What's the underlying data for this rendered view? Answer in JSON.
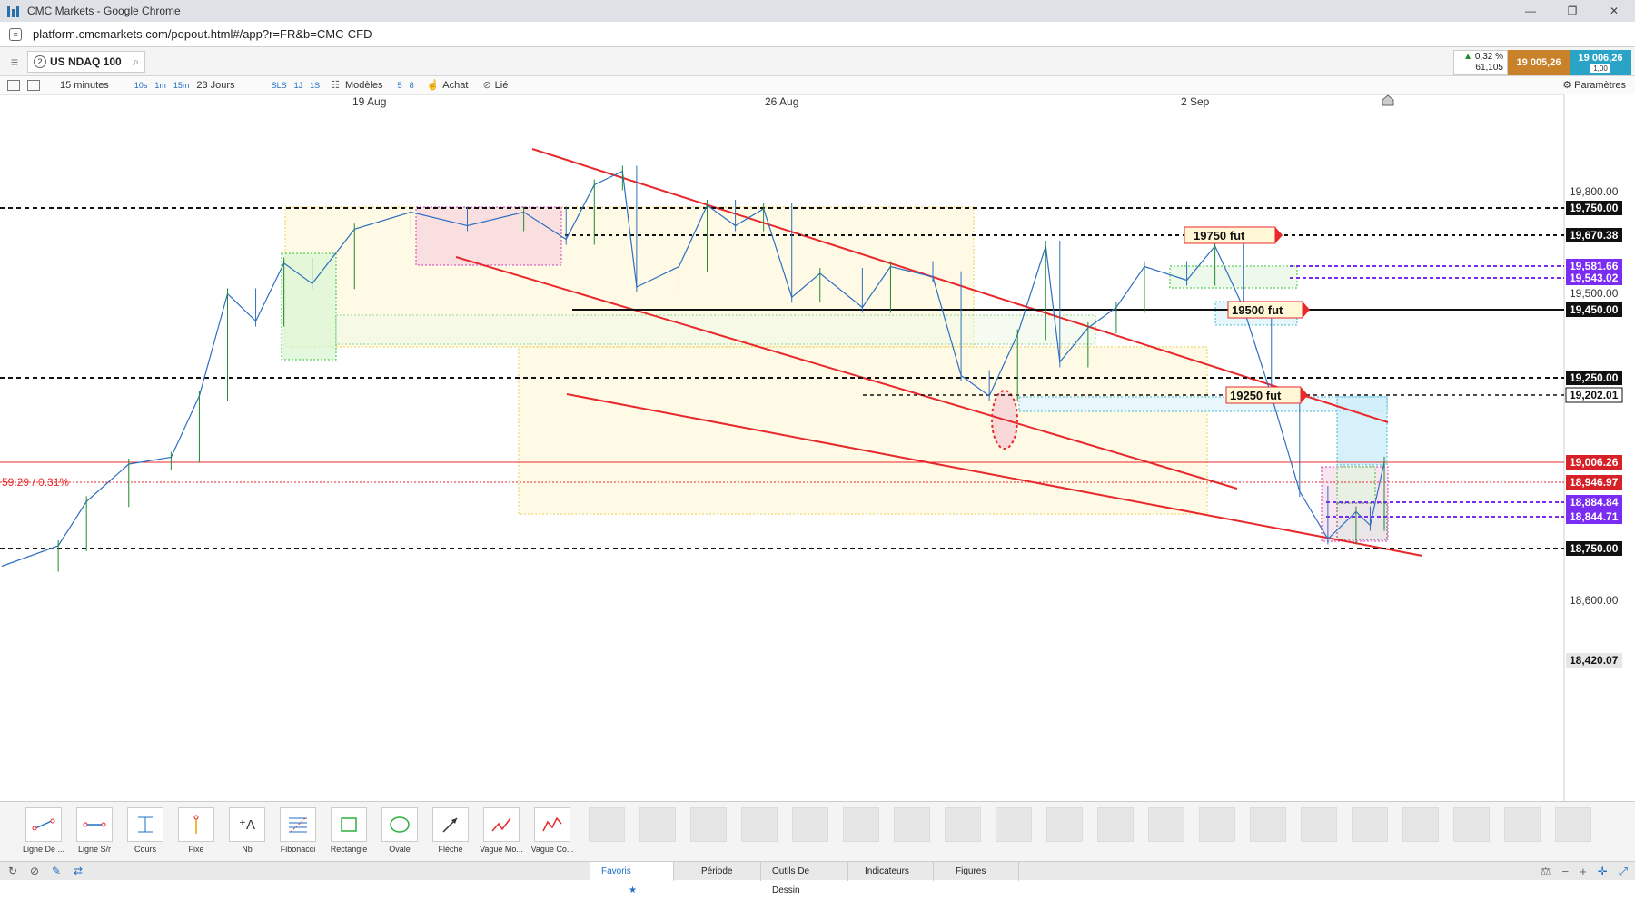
{
  "browser": {
    "window_title": "CMC Markets - Google Chrome",
    "url": "platform.cmcmarkets.com/popout.html#/app?r=FR&b=CMC-CFD"
  },
  "instrument": {
    "badge": "2",
    "name": "US NDAQ 100"
  },
  "quote": {
    "change_pct": "0,32 %",
    "change_pts": "61,105",
    "sell": "19 005,26",
    "buy": "19 006,26",
    "spread": "1,00"
  },
  "toolbar": {
    "interval": "15 minutes",
    "quick_intervals": [
      "10s",
      "1m",
      "15m"
    ],
    "range": "23 Jours",
    "quick_ranges": [
      "SLS",
      "1J",
      "1S"
    ],
    "templates": "Modèles",
    "num1": "5",
    "num2": "8",
    "buy_label": "Achat",
    "link_label": "Lié",
    "settings": "Paramètres"
  },
  "chart_data": {
    "type": "line",
    "x_labels": [
      "19 Aug",
      "26 Aug",
      "2 Sep"
    ],
    "y_ticks": [
      "19,800.00",
      "19,500.00",
      "18,600.00"
    ],
    "y_markers": [
      {
        "value": "19,750.00",
        "style": "black"
      },
      {
        "value": "19,670.38",
        "style": "black"
      },
      {
        "value": "19,581.66",
        "style": "purple"
      },
      {
        "value": "19,543.02",
        "style": "purple"
      },
      {
        "value": "19,450.00",
        "style": "black"
      },
      {
        "value": "19,250.00",
        "style": "black"
      },
      {
        "value": "19,202.01",
        "style": "outline"
      },
      {
        "value": "19,006.26",
        "style": "red"
      },
      {
        "value": "18,946.97",
        "style": "red"
      },
      {
        "value": "18,884.84",
        "style": "purple"
      },
      {
        "value": "18,844.71",
        "style": "purple"
      },
      {
        "value": "18,750.00",
        "style": "black"
      },
      {
        "value": "18,420.07",
        "style": "grey"
      }
    ],
    "annotations": [
      "19750  fut",
      "19500 fut",
      "19250  fut"
    ],
    "change_label": "59.29 / 0.31%",
    "colors": {
      "channel": "#e8282b",
      "up": "#1f8a2c",
      "down": "#2f6fbf"
    },
    "series": [
      {
        "x": 0,
        "y": 18700
      },
      {
        "x": 4,
        "y": 18760
      },
      {
        "x": 6,
        "y": 18890
      },
      {
        "x": 9,
        "y": 19000
      },
      {
        "x": 12,
        "y": 19020
      },
      {
        "x": 14,
        "y": 19200
      },
      {
        "x": 16,
        "y": 19500
      },
      {
        "x": 18,
        "y": 19420
      },
      {
        "x": 20,
        "y": 19590
      },
      {
        "x": 22,
        "y": 19530
      },
      {
        "x": 25,
        "y": 19690
      },
      {
        "x": 29,
        "y": 19740
      },
      {
        "x": 33,
        "y": 19700
      },
      {
        "x": 37,
        "y": 19740
      },
      {
        "x": 40,
        "y": 19660
      },
      {
        "x": 42,
        "y": 19820
      },
      {
        "x": 44,
        "y": 19860
      },
      {
        "x": 45,
        "y": 19520
      },
      {
        "x": 48,
        "y": 19580
      },
      {
        "x": 50,
        "y": 19760
      },
      {
        "x": 52,
        "y": 19700
      },
      {
        "x": 54,
        "y": 19750
      },
      {
        "x": 56,
        "y": 19490
      },
      {
        "x": 58,
        "y": 19560
      },
      {
        "x": 61,
        "y": 19460
      },
      {
        "x": 63,
        "y": 19580
      },
      {
        "x": 66,
        "y": 19550
      },
      {
        "x": 68,
        "y": 19260
      },
      {
        "x": 70,
        "y": 19200
      },
      {
        "x": 72,
        "y": 19380
      },
      {
        "x": 74,
        "y": 19640
      },
      {
        "x": 75,
        "y": 19300
      },
      {
        "x": 77,
        "y": 19400
      },
      {
        "x": 79,
        "y": 19460
      },
      {
        "x": 81,
        "y": 19580
      },
      {
        "x": 84,
        "y": 19540
      },
      {
        "x": 86,
        "y": 19640
      },
      {
        "x": 88,
        "y": 19460
      },
      {
        "x": 90,
        "y": 19200
      },
      {
        "x": 92,
        "y": 18920
      },
      {
        "x": 94,
        "y": 18780
      },
      {
        "x": 96,
        "y": 18860
      },
      {
        "x": 97,
        "y": 18820
      },
      {
        "x": 98,
        "y": 19006
      }
    ]
  },
  "tools": [
    "Ligne De ...",
    "Ligne S/r",
    "Cours",
    "Fixe",
    "Nb",
    "Fibonacci",
    "Rectangle",
    "Ovale",
    "Flèche",
    "Vague Mo...",
    "Vague Co..."
  ],
  "bottom_tabs": [
    "Favoris",
    "Période",
    "Outils De Dessin",
    "Indicateurs",
    "Figures"
  ]
}
